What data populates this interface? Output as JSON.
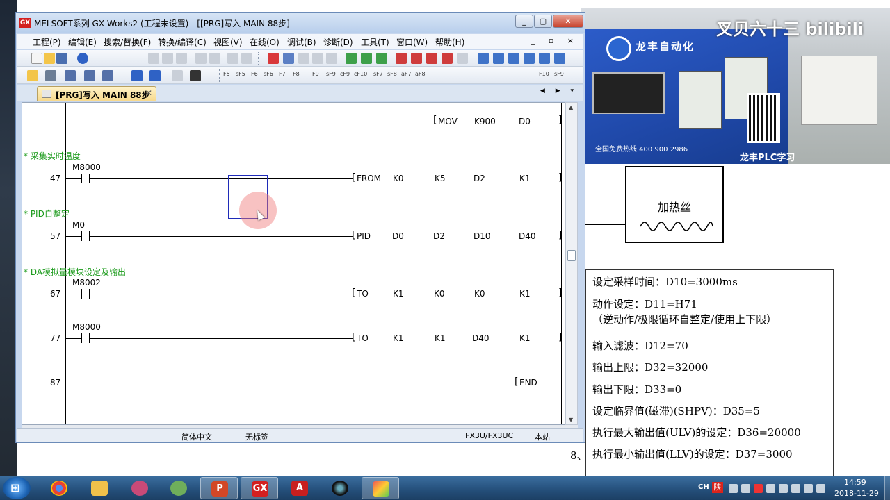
{
  "window": {
    "title": "MELSOFT系列 GX Works2 (工程未设置) - [[PRG]写入 MAIN 88步]",
    "app_icon_label": "GX",
    "controls": [
      "_",
      "▢",
      "✕"
    ]
  },
  "menubar": {
    "items": [
      "工程(P)",
      "编辑(E)",
      "搜索/替换(F)",
      "转换/编译(C)",
      "视图(V)",
      "在线(O)",
      "调试(B)",
      "诊断(D)",
      "工具(T)",
      "窗口(W)",
      "帮助(H)"
    ],
    "mdi_controls": "_ ▫ ×"
  },
  "toolbar2_keys": [
    "F5",
    "sF5",
    "F6",
    "sF6",
    "F7",
    "F8",
    "F9",
    "sF9",
    "cF9",
    "cF10",
    "sF7",
    "sF8",
    "aF7",
    "aF8",
    "F10",
    "sF9"
  ],
  "tab": {
    "label": "[PRG]写入 MAIN 88步",
    "close": "✕",
    "nav": "◀ ▶ ▾"
  },
  "ladder": {
    "mov_row": {
      "op": "MOV",
      "args": [
        "K900",
        "D0"
      ]
    },
    "rungs": [
      {
        "comment": "* 采集实时温度",
        "step": "47",
        "contact": "M8000",
        "op": "FROM",
        "args": [
          "K0",
          "K5",
          "D2",
          "K1"
        ]
      },
      {
        "comment": "* PID自整定",
        "step": "57",
        "contact": "M0",
        "op": "PID",
        "args": [
          "D0",
          "D2",
          "D10",
          "D40"
        ]
      },
      {
        "comment": "* DA模拟量模块设定及输出",
        "step": "67",
        "contact": "M8002",
        "op": "TO",
        "args": [
          "K1",
          "K0",
          "K0",
          "K1"
        ]
      },
      {
        "comment": "",
        "step": "77",
        "contact": "M8000",
        "op": "TO",
        "args": [
          "K1",
          "K1",
          "D40",
          "K1"
        ]
      }
    ],
    "end_rung": {
      "step": "87",
      "op": "END"
    }
  },
  "statusbar": {
    "language": "简体中文",
    "label_status": "无标签",
    "cpu": "FX3U/FX3UC",
    "station": "本站"
  },
  "document": {
    "heater_label": "加热丝",
    "params": [
      "设定采样时间：D10=3000ms",
      "动作设定：D11=H71",
      "（逆动作/极限循环自整定/使用上下限）",
      "输入滤波：D12=70",
      "输出上限：D32=32000",
      "输出下限：D33=0",
      "设定临界值(磁滞)(SHPV)：D35=5",
      "执行最大输出值(ULV)的设定：D36=20000",
      "执行最小输出值(LLV)的设定：D37=3000"
    ],
    "outside_number": "8、"
  },
  "video": {
    "brand": "龙丰自动化",
    "phone": "全国免费热线 400 900 2986",
    "study": "龙丰PLC学习",
    "watermark": "叉贝六十三 bilibili"
  },
  "taskbar": {
    "apps": [
      "windows-explorer",
      "chrome",
      "file-manager",
      "screenshot-tool",
      "paint",
      "powerpoint",
      "gx-works",
      "pdf-reader",
      "camera",
      "video-recorder"
    ],
    "tray_lang": "CH",
    "tray_ime": "陕",
    "time": "14:59",
    "date": "2018-11-29"
  },
  "colors": {
    "comment_green": "#1a9a1a",
    "cursor_blue": "#1f2bb8",
    "titlebar": "#c7d7ee",
    "taskbar": "#244e79"
  }
}
